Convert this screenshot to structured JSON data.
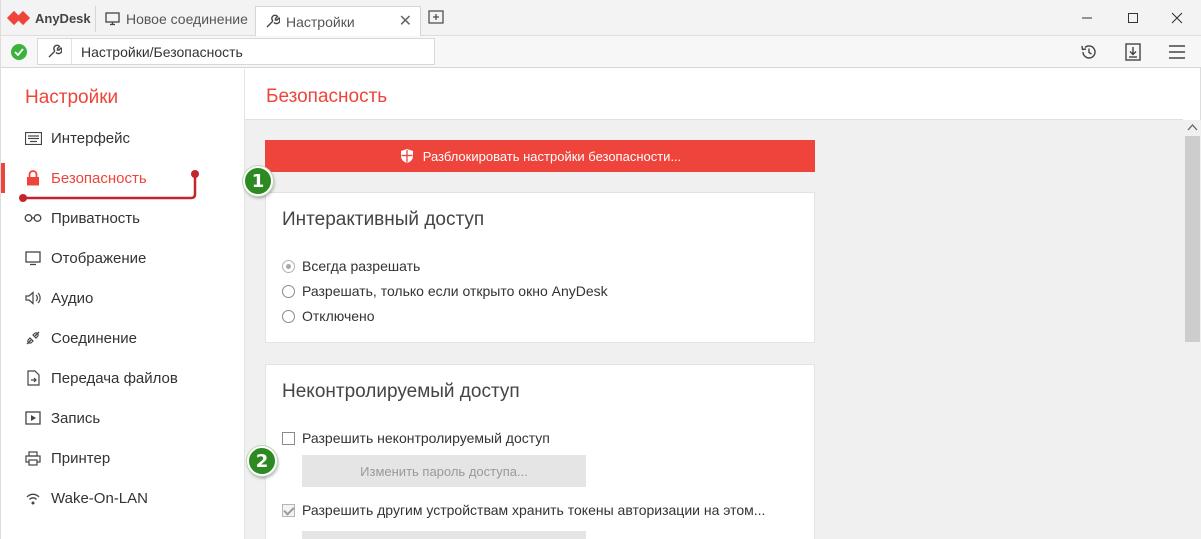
{
  "app": {
    "name": "AnyDesk"
  },
  "tabs": [
    {
      "label": "Новое соединение",
      "icon": "monitor-icon"
    },
    {
      "label": "Настройки",
      "icon": "wrench-icon",
      "active": true
    }
  ],
  "address": {
    "value": "Настройки/Безопасность",
    "status": "connected",
    "status_color": "#3bb33b"
  },
  "sidebar": {
    "title": "Настройки",
    "items": [
      {
        "label": "Интерфейс",
        "icon": "keyboard-icon"
      },
      {
        "label": "Безопасность",
        "icon": "lock-icon",
        "active": true
      },
      {
        "label": "Приватность",
        "icon": "glasses-icon"
      },
      {
        "label": "Отображение",
        "icon": "monitor-icon"
      },
      {
        "label": "Аудио",
        "icon": "speaker-icon"
      },
      {
        "label": "Соединение",
        "icon": "connection-icon"
      },
      {
        "label": "Передача файлов",
        "icon": "file-transfer-icon"
      },
      {
        "label": "Запись",
        "icon": "record-icon"
      },
      {
        "label": "Принтер",
        "icon": "printer-icon"
      },
      {
        "label": "Wake-On-LAN",
        "icon": "wifi-icon"
      }
    ]
  },
  "main": {
    "title": "Безопасность",
    "unlock_button": "Разблокировать настройки безопасности...",
    "interactive": {
      "title": "Интерактивный доступ",
      "options": [
        {
          "label": "Всегда разрешать",
          "selected": true
        },
        {
          "label": "Разрешать, только если открыто окно AnyDesk",
          "selected": false
        },
        {
          "label": "Отключено",
          "selected": false
        }
      ]
    },
    "unattended": {
      "title": "Неконтролируемый доступ",
      "allow_label": "Разрешить неконтролируемый доступ",
      "allow_checked": false,
      "change_password_button": "Изменить пароль доступа...",
      "tokens_label": "Разрешить другим устройствам хранить токены авторизации на этом...",
      "tokens_checked": true
    }
  },
  "annotations": {
    "badge1": "1",
    "badge2": "2"
  },
  "colors": {
    "accent": "#ef443b",
    "badge": "#2d8a22"
  }
}
